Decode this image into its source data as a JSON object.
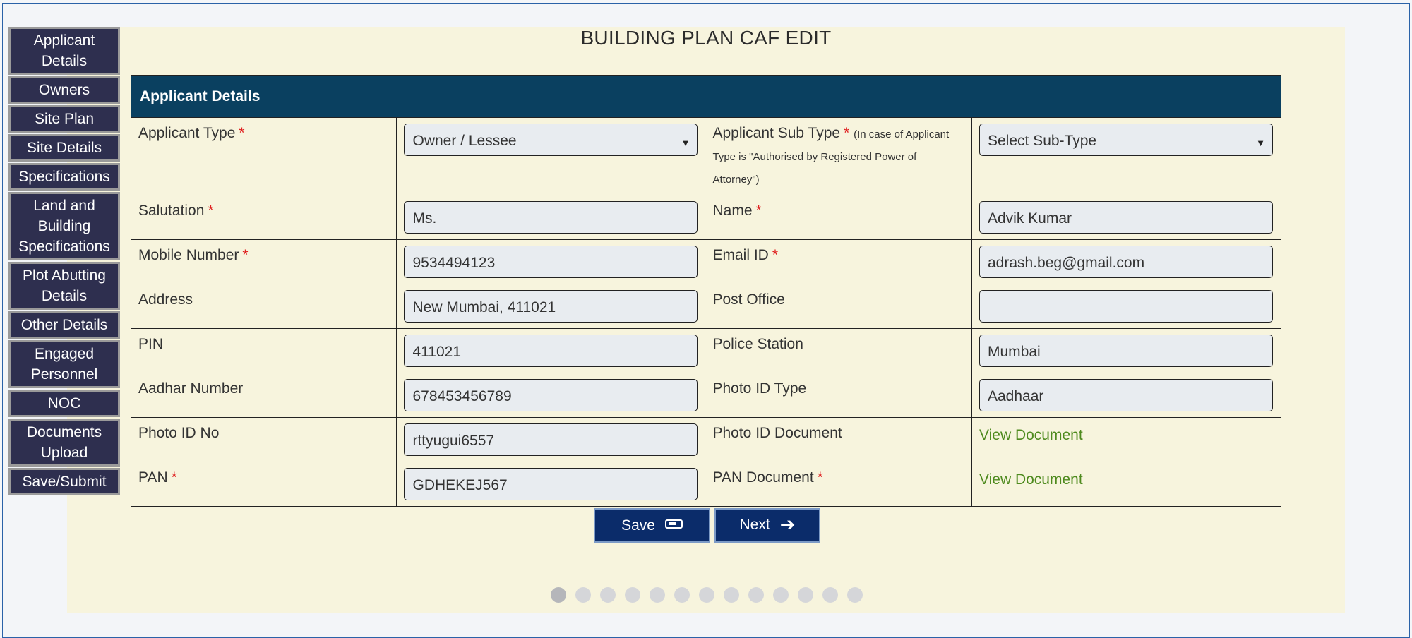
{
  "page": {
    "title": "BUILDING PLAN CAF EDIT"
  },
  "sidebar": {
    "items": [
      {
        "label": "Applicant Details"
      },
      {
        "label": "Owners"
      },
      {
        "label": "Site Plan"
      },
      {
        "label": "Site Details"
      },
      {
        "label": "Specifications"
      },
      {
        "label": "Land and Building Specifications"
      },
      {
        "label": "Plot Abutting Details"
      },
      {
        "label": "Other Details"
      },
      {
        "label": "Engaged Personnel"
      },
      {
        "label": "NOC"
      },
      {
        "label": "Documents Upload"
      },
      {
        "label": "Save/Submit"
      }
    ]
  },
  "section": {
    "title": "Applicant Details"
  },
  "form": {
    "applicant_type": {
      "label": "Applicant Type",
      "value": "Owner / Lessee"
    },
    "applicant_sub_type": {
      "label": "Applicant Sub Type",
      "note": "(In case of Applicant Type is \"Authorised by Registered Power of Attorney\")",
      "value": "Select Sub-Type"
    },
    "salutation": {
      "label": "Salutation",
      "value": "Ms."
    },
    "name": {
      "label": "Name",
      "value": "Advik Kumar"
    },
    "mobile": {
      "label": "Mobile Number",
      "value": "9534494123"
    },
    "email": {
      "label": "Email ID",
      "value": "adrash.beg@gmail.com"
    },
    "address": {
      "label": "Address",
      "value": "New Mumbai, 411021"
    },
    "post_office": {
      "label": "Post Office",
      "value": ""
    },
    "pin": {
      "label": "PIN",
      "value": "411021"
    },
    "police_station": {
      "label": "Police Station",
      "value": "Mumbai"
    },
    "aadhar": {
      "label": "Aadhar Number",
      "value": "678453456789"
    },
    "photo_id_type": {
      "label": "Photo ID Type",
      "value": "Aadhaar"
    },
    "photo_id_no": {
      "label": "Photo ID No",
      "value": "rttyugui6557"
    },
    "photo_id_document": {
      "label": "Photo ID Document",
      "link": "View Document"
    },
    "pan": {
      "label": "PAN",
      "value": "GDHEKEJ567"
    },
    "pan_document": {
      "label": "PAN Document",
      "link": "View Document"
    },
    "required_marker": "*"
  },
  "actions": {
    "save_label": "Save",
    "next_label": "Next"
  },
  "pagination": {
    "total": 13,
    "active": 1
  },
  "colors": {
    "sidebar_bg": "#2e2f4f",
    "section_header": "#0a4060",
    "panel_bg": "#f7f4dd",
    "button_bg": "#0b2c6a",
    "link": "#4e8a1e",
    "required": "#e02020"
  },
  "icons": {
    "save": "battery-icon",
    "next": "arrow-right-icon",
    "select": "caret-down-icon"
  }
}
